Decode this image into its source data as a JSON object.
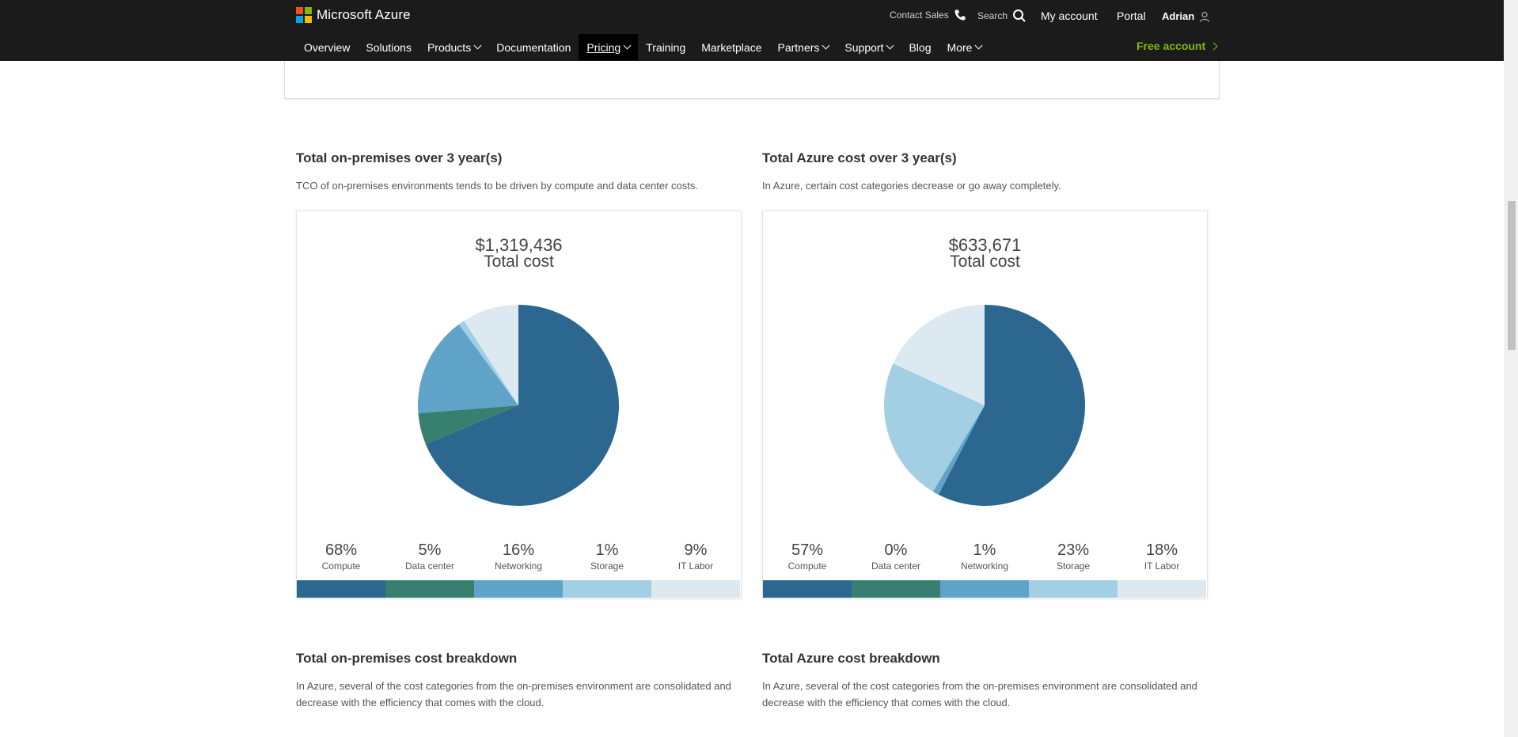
{
  "header": {
    "logo_text": "Microsoft Azure",
    "contact_sales": "Contact Sales",
    "search": "Search",
    "my_account": "My account",
    "portal": "Portal",
    "user": "Adrian",
    "free_account": "Free account",
    "nav": [
      {
        "label": "Overview",
        "dropdown": false
      },
      {
        "label": "Solutions",
        "dropdown": false
      },
      {
        "label": "Products",
        "dropdown": true
      },
      {
        "label": "Documentation",
        "dropdown": false
      },
      {
        "label": "Pricing",
        "dropdown": true,
        "active": true
      },
      {
        "label": "Training",
        "dropdown": false
      },
      {
        "label": "Marketplace",
        "dropdown": false
      },
      {
        "label": "Partners",
        "dropdown": true
      },
      {
        "label": "Support",
        "dropdown": true
      },
      {
        "label": "Blog",
        "dropdown": false
      },
      {
        "label": "More",
        "dropdown": true
      }
    ]
  },
  "colors": {
    "topbar": "#1b1b1c",
    "free_account": "#7fba00",
    "compute": "#2b678f",
    "data_center": "#37806f",
    "networking": "#5fa3c9",
    "storage": "#a3cfe4",
    "it_labor": "#dde9f0"
  },
  "onprem": {
    "title": "Total on-premises over 3 year(s)",
    "subtitle": "TCO of on-premises environments tends to be driven by compute and data center costs.",
    "total_value": "$1,319,436",
    "total_label": "Total cost",
    "legend": [
      {
        "pct": "68%",
        "label": "Compute"
      },
      {
        "pct": "5%",
        "label": "Data center"
      },
      {
        "pct": "16%",
        "label": "Networking"
      },
      {
        "pct": "1%",
        "label": "Storage"
      },
      {
        "pct": "9%",
        "label": "IT Labor"
      }
    ]
  },
  "azure": {
    "title": "Total Azure cost over 3 year(s)",
    "subtitle": "In Azure, certain cost categories decrease or go away completely.",
    "total_value": "$633,671",
    "total_label": "Total cost",
    "legend": [
      {
        "pct": "57%",
        "label": "Compute"
      },
      {
        "pct": "0%",
        "label": "Data center"
      },
      {
        "pct": "1%",
        "label": "Networking"
      },
      {
        "pct": "23%",
        "label": "Storage"
      },
      {
        "pct": "18%",
        "label": "IT Labor"
      }
    ]
  },
  "onprem_breakdown": {
    "title": "Total on-premises cost breakdown",
    "subtitle": "In Azure, several of the cost categories from the on-premises environment are consolidated and decrease with the efficiency that comes with the cloud."
  },
  "azure_breakdown": {
    "title": "Total Azure cost breakdown",
    "subtitle": "In Azure, several of the cost categories from the on-premises environment are consolidated and decrease with the efficiency that comes with the cloud."
  },
  "chart_data": [
    {
      "type": "pie",
      "categories": [
        "Compute",
        "Data center",
        "Networking",
        "Storage",
        "IT Labor"
      ],
      "values": [
        68,
        5,
        16,
        1,
        9
      ],
      "title": "Total cost",
      "total": "$1,319,436"
    },
    {
      "type": "pie",
      "categories": [
        "Compute",
        "Data center",
        "Networking",
        "Storage",
        "IT Labor"
      ],
      "values": [
        57,
        0,
        1,
        23,
        18
      ],
      "title": "Total cost",
      "total": "$633,671"
    }
  ]
}
